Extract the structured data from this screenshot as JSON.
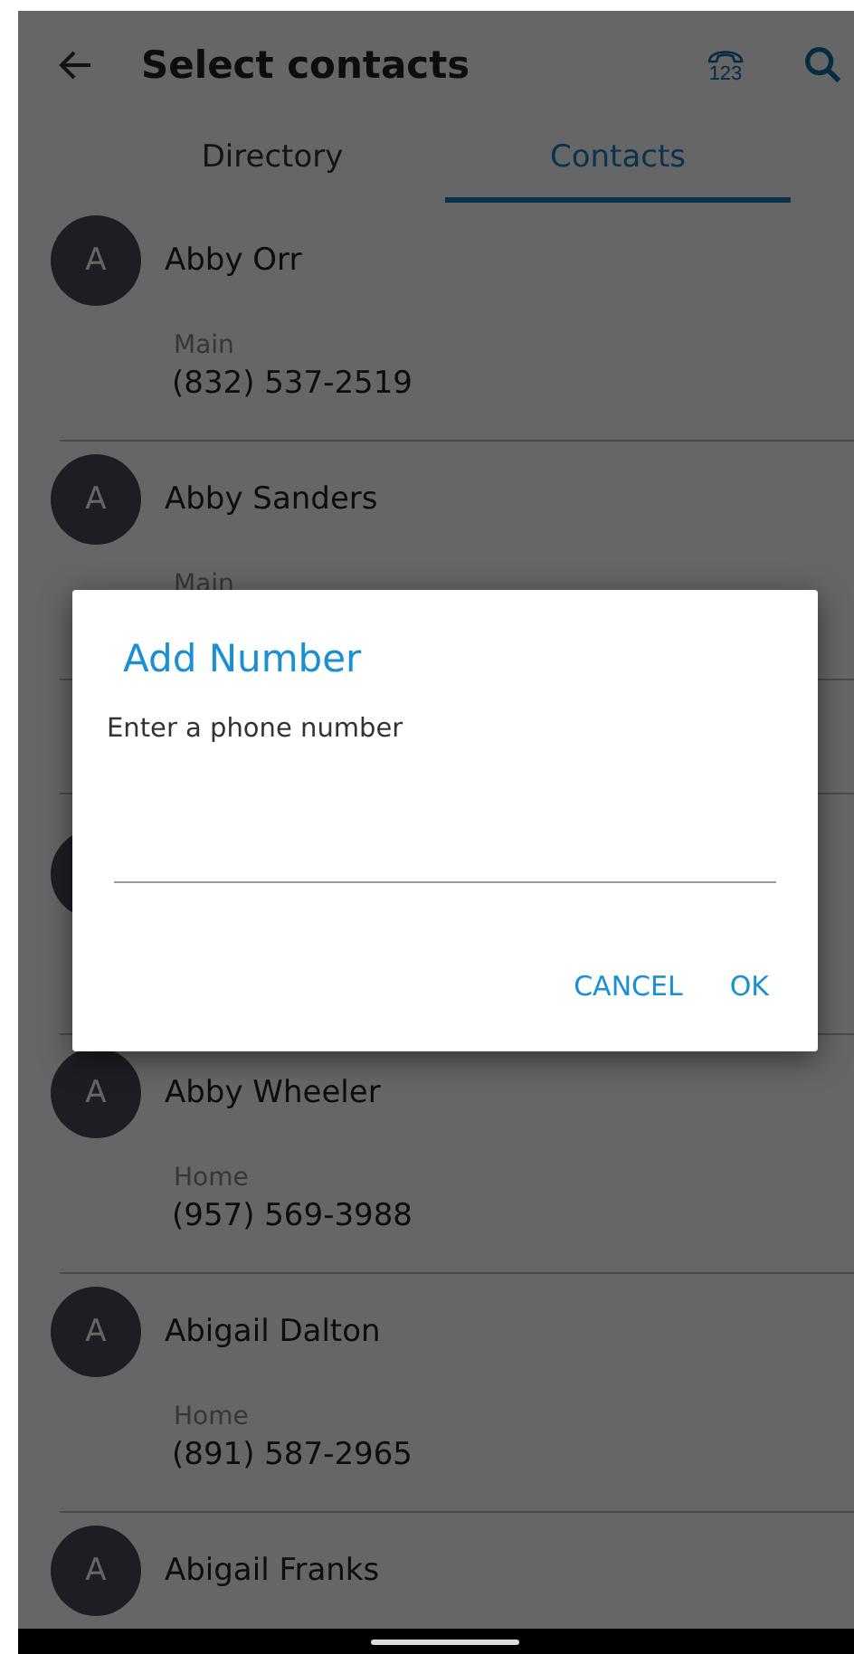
{
  "header": {
    "title": "Select contacts",
    "keypad_label": "123"
  },
  "tabs": [
    {
      "label": "Directory",
      "selected": false
    },
    {
      "label": "Contacts",
      "selected": true
    }
  ],
  "contacts": [
    {
      "initial": "A",
      "name": "Abby Orr",
      "label": "Main",
      "number": "(832) 537-2519"
    },
    {
      "initial": "A",
      "name": "Abby Sanders",
      "label": "Main"
    },
    {
      "kind": "covered"
    },
    {
      "initial": "A",
      "name": "Abby Wheeler",
      "label": "Home",
      "number": "(957) 569-3988"
    },
    {
      "initial": "A",
      "name": "Abigail Dalton",
      "label": "Home",
      "number": "(891) 587-2965"
    },
    {
      "initial": "A",
      "name": "Abigail Franks"
    }
  ],
  "dialog": {
    "title": "Add Number",
    "message": "Enter a phone number",
    "buttons": [
      "CANCEL",
      "OK"
    ]
  }
}
